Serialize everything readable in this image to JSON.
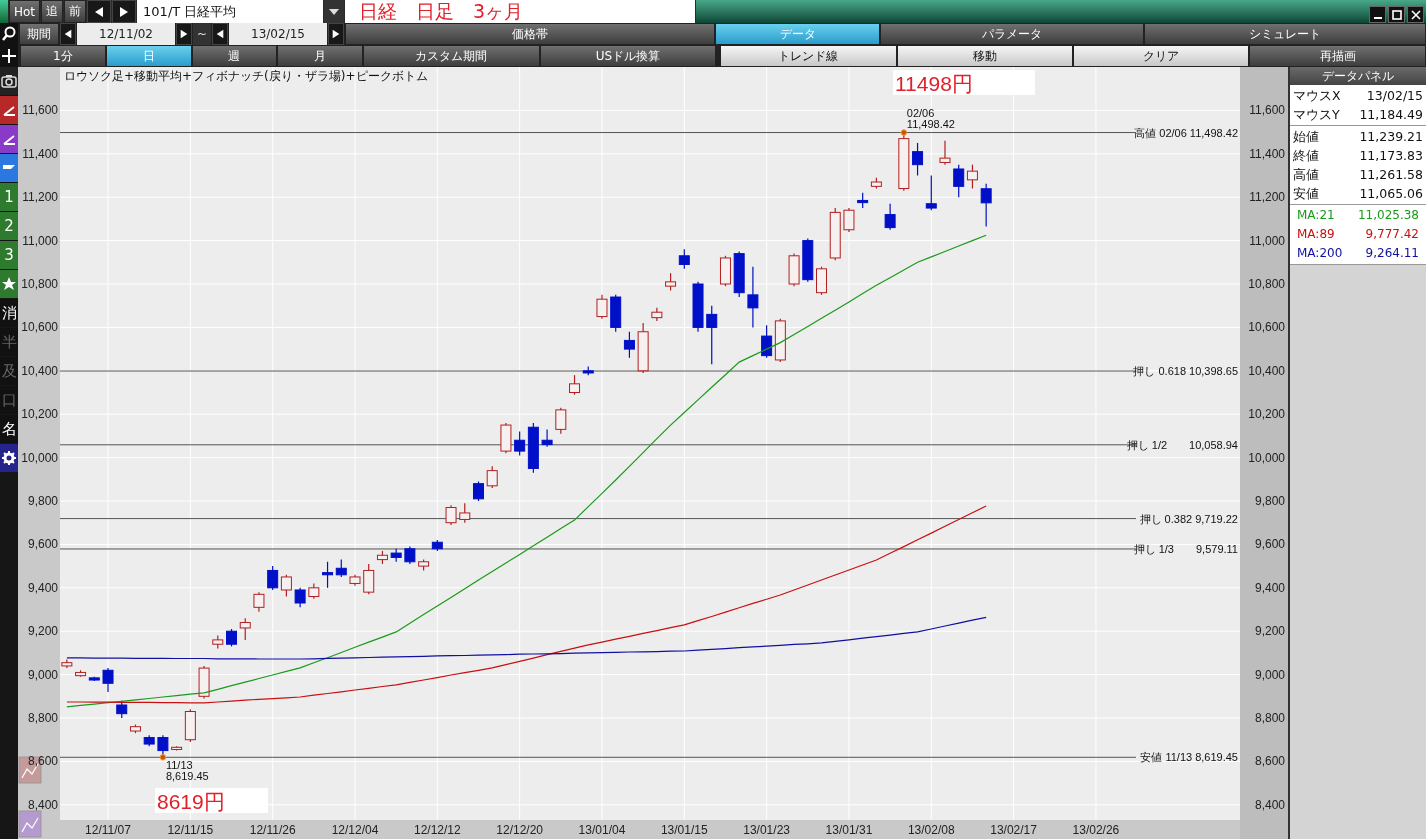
{
  "toolbar": {
    "buttons": [
      "Hot",
      "追",
      "前"
    ],
    "symbol": "101/T 日経平均",
    "title": "日経　日足　3ヶ月"
  },
  "period": {
    "label": "期間",
    "from": "12/11/02",
    "separator": "~",
    "to": "13/02/15"
  },
  "tabs": [
    {
      "label": "価格帯",
      "selected": false
    },
    {
      "label": "データ",
      "selected": true
    },
    {
      "label": "パラメータ",
      "selected": false
    },
    {
      "label": "シミュレート",
      "selected": false
    }
  ],
  "intervals": [
    {
      "label": "1分",
      "kind": "period",
      "selected": false
    },
    {
      "label": "日",
      "kind": "period",
      "selected": true
    },
    {
      "label": "週",
      "kind": "period",
      "selected": false
    },
    {
      "label": "月",
      "kind": "period",
      "selected": false
    },
    {
      "label": "カスタム期間",
      "kind": "flat",
      "selected": false
    },
    {
      "label": "USドル換算",
      "kind": "flat",
      "selected": false
    },
    {
      "label": "トレンド線",
      "kind": "raised",
      "selected": false
    },
    {
      "label": "移動",
      "kind": "raised",
      "selected": false
    },
    {
      "label": "クリア",
      "kind": "raised",
      "selected": false
    },
    {
      "label": "再描画",
      "kind": "flat",
      "selected": false
    }
  ],
  "numbered_keys": [
    "1",
    "2",
    "3"
  ],
  "text_keys": [
    {
      "text": "消",
      "disabled": false
    },
    {
      "text": "半",
      "disabled": true
    },
    {
      "text": "及",
      "disabled": true
    },
    {
      "text": "口",
      "disabled": true
    },
    {
      "text": "名",
      "disabled": false
    }
  ],
  "chart": {
    "title": "ロウソク足+移動平均+フィボナッチ(戻り・ザラ場)+ピークボトム",
    "price_labels": [
      "11498円",
      "8619円"
    ],
    "chart_data": {
      "type": "candlestick",
      "grid": true,
      "ylim": [
        8330,
        11800
      ],
      "categories": [
        null,
        null,
        null,
        "12/11/07",
        null,
        null,
        null,
        null,
        null,
        "12/11/15",
        null,
        null,
        null,
        null,
        null,
        "12/11/26",
        null,
        null,
        null,
        null,
        null,
        "12/12/04",
        null,
        null,
        null,
        null,
        null,
        "12/12/12",
        null,
        null,
        null,
        null,
        null,
        "12/12/20",
        null,
        null,
        null,
        null,
        null,
        "13/01/04",
        null,
        null,
        null,
        null,
        null,
        "13/01/15",
        null,
        null,
        null,
        null,
        null,
        "13/01/23",
        null,
        null,
        null,
        null,
        null,
        "13/01/31",
        null,
        null,
        null,
        null,
        null,
        "13/02/08",
        null,
        null,
        null,
        null,
        null,
        "13/02/17",
        null,
        null,
        null,
        null,
        null,
        "13/02/26",
        null,
        null,
        null,
        null,
        null,
        null,
        null,
        null,
        null,
        null
      ],
      "yticks": [
        {
          "value": 8400,
          "label": "8,400"
        },
        {
          "value": 8600,
          "label": "8,600"
        },
        {
          "value": 8800,
          "label": "8,800"
        },
        {
          "value": 9000,
          "label": "9,000"
        },
        {
          "value": 9200,
          "label": "9,200"
        },
        {
          "value": 9400,
          "label": "9,400"
        },
        {
          "value": 9600,
          "label": "9,600"
        },
        {
          "value": 9800,
          "label": "9,800"
        },
        {
          "value": 10000,
          "label": "10,000"
        },
        {
          "value": 10200,
          "label": "10,200"
        },
        {
          "value": 10400,
          "label": "10,400"
        },
        {
          "value": 10600,
          "label": "10,600"
        },
        {
          "value": 10800,
          "label": "10,800"
        },
        {
          "value": 11000,
          "label": "11,000"
        },
        {
          "value": 11200,
          "label": "11,200"
        },
        {
          "value": 11400,
          "label": "11,400"
        },
        {
          "value": 11600,
          "label": "11,600"
        }
      ],
      "ohlc": [
        [
          9040,
          9070,
          9030,
          9055
        ],
        [
          8995,
          9020,
          8990,
          9010
        ],
        [
          8985,
          8990,
          8970,
          8975
        ],
        [
          9020,
          9030,
          8920,
          8960
        ],
        [
          8860,
          8880,
          8800,
          8820
        ],
        [
          8740,
          8770,
          8730,
          8760
        ],
        [
          8710,
          8720,
          8670,
          8680
        ],
        [
          8710,
          8720,
          8619,
          8650
        ],
        [
          8655,
          8670,
          8650,
          8665
        ],
        [
          8700,
          8840,
          8690,
          8830
        ],
        [
          8900,
          9040,
          8890,
          9030
        ],
        [
          9140,
          9180,
          9120,
          9160
        ],
        [
          9200,
          9210,
          9130,
          9140
        ],
        [
          9215,
          9260,
          9160,
          9240
        ],
        [
          9310,
          9380,
          9290,
          9370
        ],
        [
          9480,
          9500,
          9390,
          9400
        ],
        [
          9390,
          9460,
          9360,
          9450
        ],
        [
          9390,
          9400,
          9310,
          9330
        ],
        [
          9360,
          9420,
          9350,
          9400
        ],
        [
          9470,
          9520,
          9400,
          9460
        ],
        [
          9490,
          9530,
          9450,
          9460
        ],
        [
          9420,
          9460,
          9410,
          9450
        ],
        [
          9380,
          9510,
          9370,
          9480
        ],
        [
          9530,
          9570,
          9510,
          9550
        ],
        [
          9560,
          9580,
          9520,
          9540
        ],
        [
          9580,
          9590,
          9510,
          9520
        ],
        [
          9500,
          9530,
          9480,
          9520
        ],
        [
          9610,
          9620,
          9570,
          9580
        ],
        [
          9700,
          9780,
          9690,
          9770
        ],
        [
          9715,
          9790,
          9700,
          9745
        ],
        [
          9880,
          9890,
          9800,
          9810
        ],
        [
          9870,
          9960,
          9860,
          9940
        ],
        [
          10030,
          10160,
          10020,
          10150
        ],
        [
          10080,
          10120,
          10010,
          10030
        ],
        [
          10140,
          10160,
          9930,
          9950
        ],
        [
          10080,
          10130,
          10050,
          10060
        ],
        [
          10130,
          10230,
          10110,
          10220
        ],
        [
          10300,
          10380,
          10290,
          10340
        ],
        [
          10400,
          10420,
          10380,
          10390
        ],
        [
          10650,
          10750,
          10640,
          10730
        ],
        [
          10740,
          10750,
          10580,
          10600
        ],
        [
          10540,
          10580,
          10460,
          10500
        ],
        [
          10400,
          10620,
          10390,
          10580
        ],
        [
          10645,
          10690,
          10630,
          10670
        ],
        [
          10790,
          10850,
          10770,
          10810
        ],
        [
          10930,
          10960,
          10870,
          10890
        ],
        [
          10800,
          10810,
          10580,
          10600
        ],
        [
          10660,
          10700,
          10430,
          10600
        ],
        [
          10800,
          10930,
          10790,
          10920
        ],
        [
          10940,
          10950,
          10740,
          10760
        ],
        [
          10750,
          10880,
          10600,
          10690
        ],
        [
          10560,
          10610,
          10460,
          10470
        ],
        [
          10450,
          10640,
          10440,
          10630
        ],
        [
          10800,
          10940,
          10790,
          10930
        ],
        [
          11000,
          11010,
          10810,
          10820
        ],
        [
          10760,
          10880,
          10750,
          10870
        ],
        [
          10920,
          11150,
          10910,
          11130
        ],
        [
          11050,
          11150,
          11040,
          11140
        ],
        [
          11185,
          11220,
          11150,
          11175
        ],
        [
          11250,
          11290,
          11240,
          11270
        ],
        [
          11120,
          11170,
          11050,
          11060
        ],
        [
          11240,
          11498,
          11230,
          11470
        ],
        [
          11410,
          11450,
          11300,
          11350
        ],
        [
          11170,
          11300,
          11140,
          11150
        ],
        [
          11360,
          11460,
          11350,
          11380
        ],
        [
          11330,
          11350,
          11200,
          11250
        ],
        [
          11280,
          11350,
          11240,
          11320
        ],
        [
          11239,
          11262,
          11065,
          11174
        ],
        null,
        null,
        null,
        null,
        null,
        null,
        null,
        null,
        null,
        null,
        null,
        null,
        null,
        null,
        null,
        null,
        null,
        null
      ],
      "series": [
        {
          "type": "line",
          "color": "#1a9a1a",
          "values": [
            8851,
            8858,
            8864,
            8871,
            8877,
            8884,
            8890,
            8897,
            8903,
            8910,
            8916,
            8932,
            8949,
            8965,
            8982,
            8998,
            9015,
            9031,
            9055,
            9078,
            9102,
            9126,
            9150,
            9173,
            9197,
            9237,
            9277,
            9316,
            9356,
            9396,
            9436,
            9475,
            9515,
            9554,
            9594,
            9633,
            9673,
            9712,
            9774,
            9835,
            9897,
            9960,
            10023,
            10087,
            10150,
            10208,
            10266,
            10324,
            10382,
            10440,
            10470,
            10500,
            10530,
            10567,
            10604,
            10642,
            10679,
            10717,
            10756,
            10794,
            10829,
            10865,
            10900,
            10925,
            10950,
            10975,
            11000,
            11025,
            null,
            null,
            null,
            null,
            null,
            null,
            null,
            null,
            null,
            null,
            null,
            null,
            null,
            null,
            null,
            null,
            null,
            null
          ]
        },
        {
          "type": "line",
          "color": "#c81010",
          "values": [
            8874,
            8874,
            8873,
            8873,
            8872,
            8872,
            8872,
            8871,
            8871,
            8870,
            8870,
            8874,
            8878,
            8882,
            8886,
            8889,
            8893,
            8897,
            8905,
            8913,
            8921,
            8929,
            8937,
            8945,
            8953,
            8964,
            8975,
            8986,
            8998,
            9009,
            9020,
            9031,
            9046,
            9061,
            9076,
            9092,
            9107,
            9122,
            9137,
            9150,
            9163,
            9176,
            9190,
            9203,
            9216,
            9229,
            9249,
            9268,
            9288,
            9308,
            9328,
            9347,
            9367,
            9390,
            9413,
            9436,
            9459,
            9482,
            9505,
            9528,
            9559,
            9590,
            9621,
            9652,
            9684,
            9715,
            9746,
            9777,
            null,
            null,
            null,
            null,
            null,
            null,
            null,
            null,
            null,
            null,
            null,
            null,
            null,
            null,
            null,
            null,
            null,
            null
          ]
        },
        {
          "type": "line",
          "color": "#1010a0",
          "values": [
            9077,
            9077,
            9076,
            9076,
            9076,
            9075,
            9075,
            9075,
            9074,
            9074,
            9074,
            9073,
            9073,
            9073,
            9072,
            9072,
            9072,
            9072,
            9073,
            9075,
            9076,
            9077,
            9079,
            9080,
            9082,
            9083,
            9084,
            9086,
            9087,
            9088,
            9090,
            9091,
            9092,
            9094,
            9095,
            9096,
            9097,
            9099,
            9100,
            9101,
            9103,
            9104,
            9105,
            9106,
            9108,
            9109,
            9113,
            9116,
            9120,
            9124,
            9128,
            9131,
            9135,
            9139,
            9142,
            9146,
            9153,
            9160,
            9168,
            9175,
            9182,
            9190,
            9197,
            9210,
            9224,
            9237,
            9251,
            9264,
            null,
            null,
            null,
            null,
            null,
            null,
            null,
            null,
            null,
            null,
            null,
            null,
            null,
            null,
            null,
            null,
            null,
            null
          ]
        }
      ],
      "ref_lines": [
        {
          "axis": "y",
          "value": 11498,
          "label": "高値 02/06 11,498.42"
        },
        {
          "axis": "y",
          "value": 10399,
          "label": "押し 0.618 10,398.65"
        },
        {
          "axis": "y",
          "value": 10059,
          "label": "押し 1/2　　10,058.94"
        },
        {
          "axis": "y",
          "value": 9719,
          "label": "押し 0.382 9,719.22"
        },
        {
          "axis": "y",
          "value": 9579,
          "label": "押し 1/3　　9,579.11"
        },
        {
          "axis": "y",
          "value": 8619,
          "label": "安値 11/13 8,619.45"
        }
      ],
      "annotations": [
        {
          "y": 11498,
          "text": "02/06\n11,498.42"
        },
        {
          "y": 8619,
          "text": "11/13\n8,619.45"
        }
      ]
    }
  },
  "data_panel": {
    "title": "データパネル",
    "mouse": [
      {
        "label": "マウスX",
        "value": "13/02/15"
      },
      {
        "label": "マウスY",
        "value": "11,184.49"
      }
    ],
    "prices": [
      {
        "label": "始値",
        "value": "11,239.21"
      },
      {
        "label": "終値",
        "value": "11,173.83"
      },
      {
        "label": "高値",
        "value": "11,261.58"
      },
      {
        "label": "安値",
        "value": "11,065.06"
      }
    ],
    "moving_averages": [
      {
        "label": "MA:21",
        "value": "11,025.38",
        "color": "#1a9a1a"
      },
      {
        "label": "MA:89",
        "value": "9,777.42",
        "color": "#c81010"
      },
      {
        "label": "MA:200",
        "value": "9,264.11",
        "color": "#1010a0"
      }
    ]
  }
}
